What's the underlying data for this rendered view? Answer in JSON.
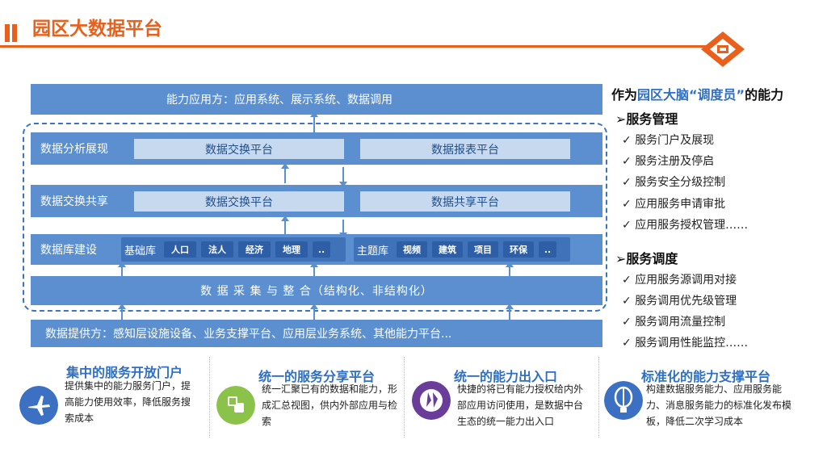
{
  "header": {
    "title": "园区大数据平台"
  },
  "diagram": {
    "top_band": "能力应用方：应用系统、展示系统、数据调用",
    "analysis": {
      "label": "数据分析展现",
      "left_box": "数据交换平台",
      "right_box": "数据报表平台"
    },
    "exchange": {
      "label": "数据交换共享",
      "left_box": "数据交换平台",
      "right_box": "数据共享平台"
    },
    "database": {
      "label": "数据库建设",
      "base": {
        "label": "基础库",
        "tags": [
          "人口",
          "法人",
          "经济",
          "地理",
          ".."
        ]
      },
      "theme": {
        "label": "主题库",
        "tags": [
          "视频",
          "建筑",
          "项目",
          "环保",
          ".."
        ]
      }
    },
    "collect": "数 据 采 集 与 整 合（结构化、非结构化）",
    "providers": "数据提供方：感知层设施设备、业务支撑平台、应用层业务系统、其他能力平台..."
  },
  "right_panel": {
    "title_prefix": "作为",
    "title_highlight": "园区大脑“调度员”",
    "title_suffix": "的能力",
    "sections": [
      {
        "title": "服务管理",
        "items": [
          "服务门户及展现",
          "服务注册及停启",
          "服务安全分级控制",
          "应用服务申请审批",
          "应用服务授权管理……"
        ]
      },
      {
        "title": "服务调度",
        "items": [
          "应用服务源调用对接",
          "服务调用优先级管理",
          "服务调用流量控制",
          "服务调用性能监控……"
        ]
      }
    ],
    "check_mark": "✓",
    "section_marker": "➢"
  },
  "bottom": [
    {
      "title": "集中的服务开放门户",
      "desc": "提供集中的能力服务门户，提高能力使用效率，降低服务搜索成本",
      "icon": "airplane-icon",
      "color": "#3b70c2"
    },
    {
      "title": "统一的服务分享平台",
      "desc": "统一汇聚已有的数据和能力，形成汇总视图，供内外部应用与检索",
      "icon": "share-icon",
      "color": "#8bc34a"
    },
    {
      "title": "统一的能力出入口",
      "desc": "快捷的将已有能力授权给内外部应用访问使用，是数据中台生态的统一能力出入口",
      "icon": "gateway-icon",
      "color": "#6a3d9a"
    },
    {
      "title": "标准化的能力支撑平台",
      "desc": "构建数据服务能力、应用服务能力、消息服务能力的标准化发布模板，降低二次学习成本",
      "icon": "balloon-icon",
      "color": "#3b70c2"
    }
  ],
  "colors": {
    "accent": "#e8601c",
    "band": "#5b8fcf",
    "light": "#c6d9ef",
    "title_blue": "#2e6fc4"
  }
}
